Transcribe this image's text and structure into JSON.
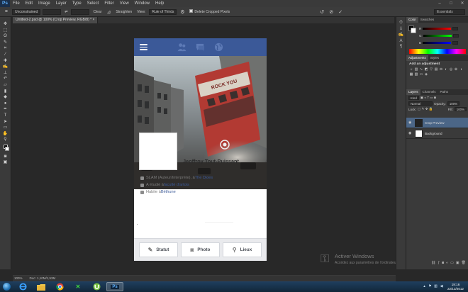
{
  "app": {
    "logo": "Ps"
  },
  "menu": [
    "File",
    "Edit",
    "Image",
    "Layer",
    "Type",
    "Select",
    "Filter",
    "View",
    "Window",
    "Help"
  ],
  "window_controls": [
    "–",
    "□",
    "✕"
  ],
  "options": {
    "ratio": "Unconstrained",
    "swap": "⇄",
    "clear": "Clear",
    "straighten": "Straighten",
    "view_label": "View:",
    "view_value": "Rule of Thirds",
    "delete_cropped": "Delete Cropped Pixels",
    "workspace": "Essentials"
  },
  "document": {
    "tab": "Untitled-2.psd @ 100% (Crop Preview, RGB/8) *"
  },
  "profile": {
    "name": "Jeoffroy Tout-Puissant",
    "work_text": "SLAM (Auteur/Interprète), à ",
    "work_link": "The Djoes",
    "study_text": "A étudié à ",
    "study_link": "faculté d'artois",
    "live_text": "Habite à ",
    "live_link": "Béthune"
  },
  "actions": {
    "status": "Statut",
    "photo": "Photo",
    "places": "Lieux"
  },
  "watermark": {
    "title": "Activer Windows",
    "subtitle": "Accédez aux paramètres de l'ordinateur pour activer Windows."
  },
  "panels": {
    "color_tab": "Color",
    "swatches_tab": "Swatches",
    "adjustments_tab": "Adjustments",
    "styles_tab": "Styles",
    "add_adjustment": "Add an adjustment",
    "layers_tab": "Layers",
    "channels_tab": "Channels",
    "paths_tab": "Paths",
    "kind": "Kind",
    "blend": "Normal",
    "opacity_label": "Opacity:",
    "opacity": "100%",
    "lock_label": "Lock:",
    "fill_label": "Fill:",
    "fill": "100%",
    "layers": [
      "Crop Preview",
      "Background"
    ],
    "slider_labels": [
      "R",
      "G",
      "B"
    ]
  },
  "status": {
    "zoom": "100%",
    "doc": "Doc: 1,10M/1,53M"
  },
  "taskbar": {
    "time": "19:16",
    "date": "22/12/2012",
    "apps": [
      "IE",
      "Explorer",
      "Chrome",
      "Xchat",
      "uTorrent",
      "Photoshop"
    ]
  },
  "colors": {
    "facebook_blue": "#3b5998",
    "ps_dark": "#282828",
    "ps_panel": "#3a3a3a",
    "selected_layer": "#4b6687"
  }
}
